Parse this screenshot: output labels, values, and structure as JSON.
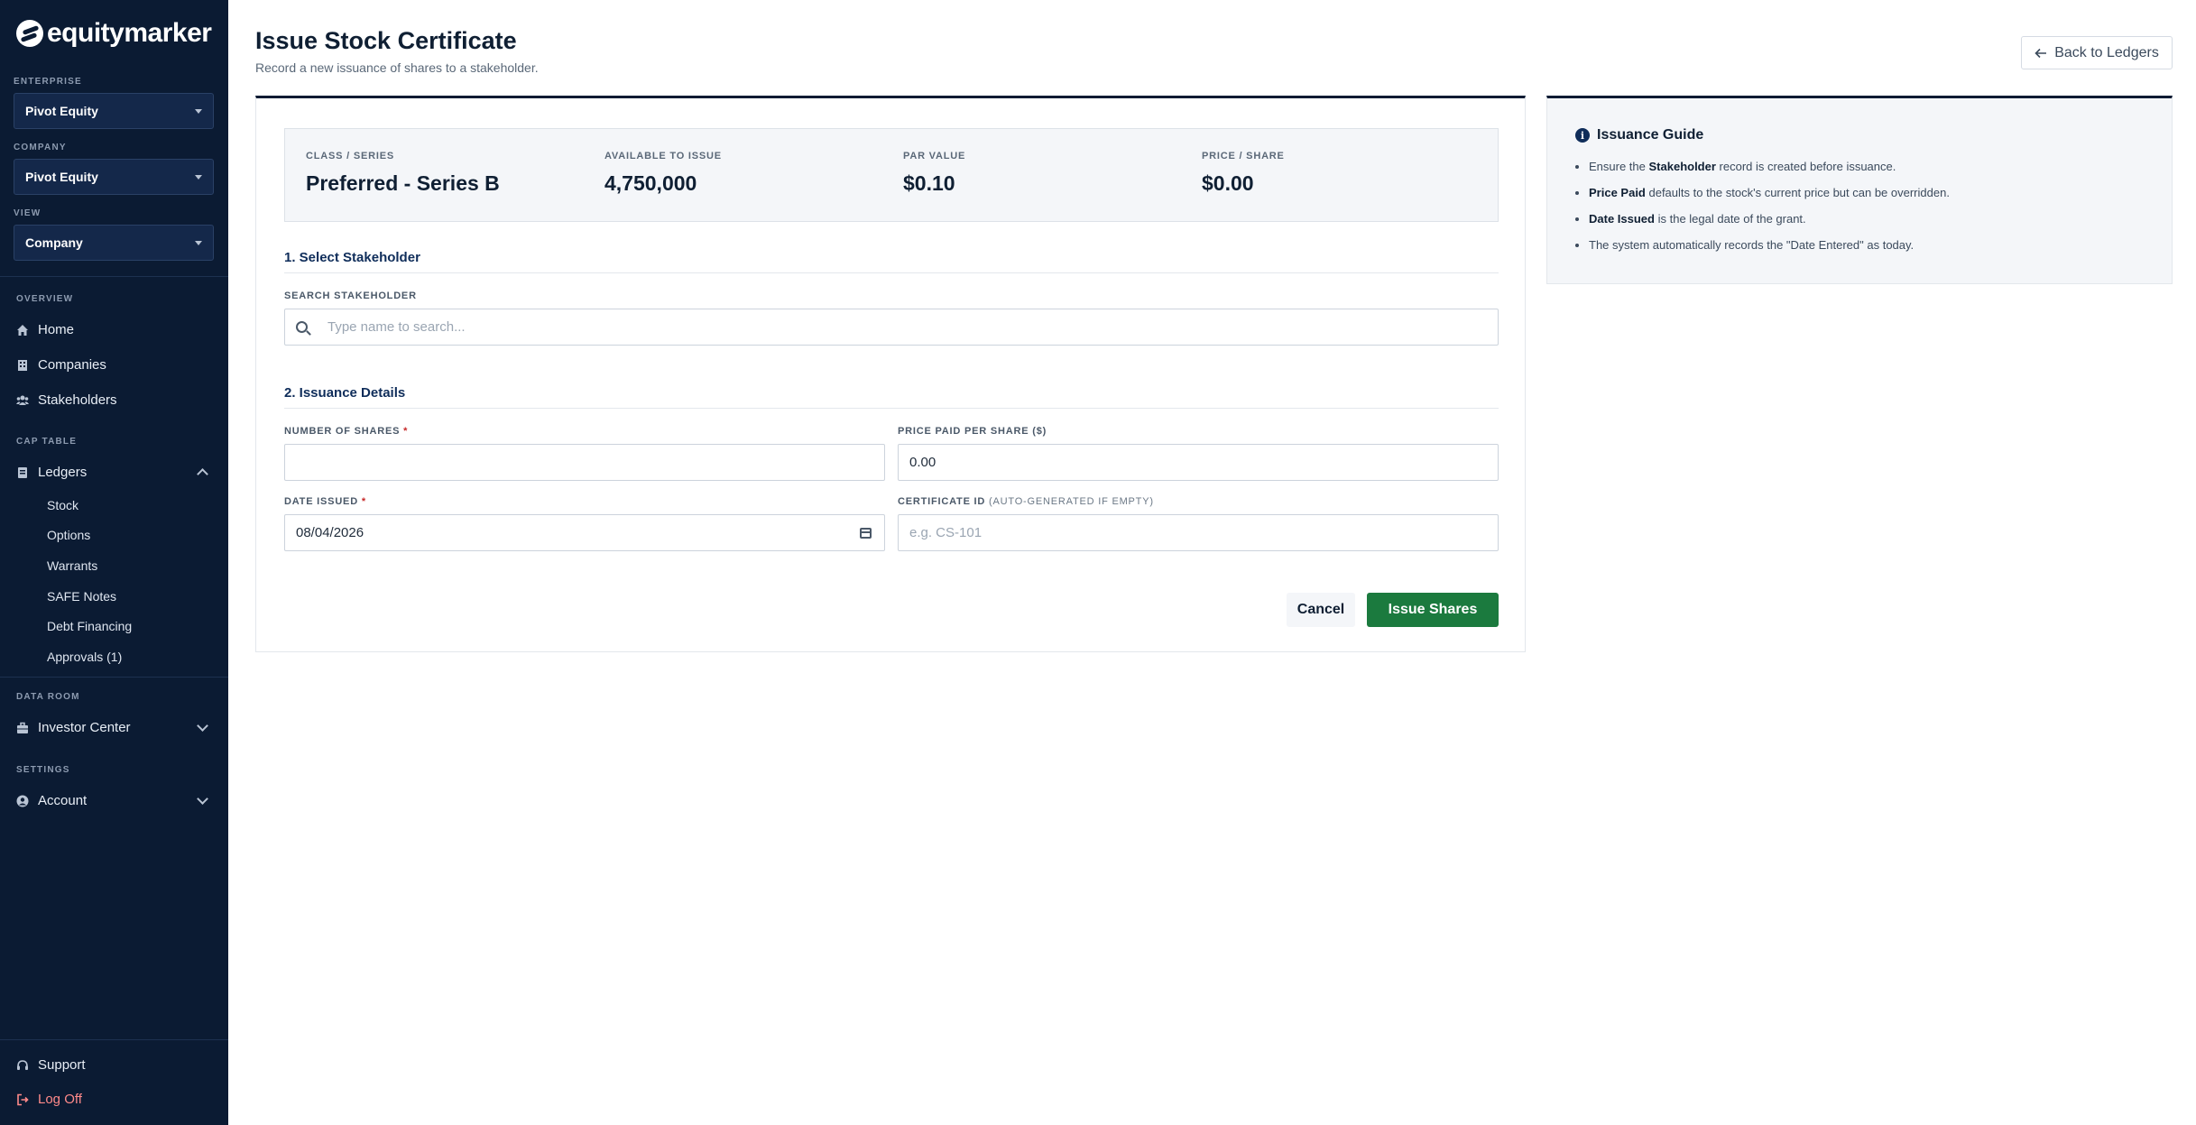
{
  "brand": {
    "name": "equitymarker"
  },
  "sidebar": {
    "enterprise_label": "ENTERPRISE",
    "enterprise_value": "Pivot Equity",
    "company_label": "COMPANY",
    "company_value": "Pivot Equity",
    "view_label": "VIEW",
    "view_value": "Company",
    "overview_label": "OVERVIEW",
    "home": "Home",
    "companies": "Companies",
    "stakeholders": "Stakeholders",
    "cap_table_label": "CAP TABLE",
    "ledgers": "Ledgers",
    "ledger_items": [
      "Stock",
      "Options",
      "Warrants",
      "SAFE Notes",
      "Debt Financing",
      "Approvals (1)"
    ],
    "data_room_label": "DATA ROOM",
    "investor_center": "Investor Center",
    "settings_label": "SETTINGS",
    "account": "Account",
    "support": "Support",
    "log_off": "Log Off"
  },
  "header": {
    "title": "Issue Stock Certificate",
    "subtitle": "Record a new issuance of shares to a stakeholder.",
    "back_label": "Back to Ledgers"
  },
  "stats": [
    {
      "label": "CLASS / SERIES",
      "value": "Preferred - Series B"
    },
    {
      "label": "AVAILABLE TO ISSUE",
      "value": "4,750,000"
    },
    {
      "label": "PAR VALUE",
      "value": "$0.10"
    },
    {
      "label": "PRICE / SHARE",
      "value": "$0.00"
    }
  ],
  "form": {
    "section1": "1. Select Stakeholder",
    "search_label": "SEARCH STAKEHOLDER",
    "search_placeholder": "Type name to search...",
    "section2": "2. Issuance Details",
    "shares_label": "NUMBER OF SHARES",
    "required_mark": "*",
    "price_label": "PRICE PAID PER SHARE ($)",
    "price_value": "0.00",
    "date_label": "DATE ISSUED",
    "date_value": "08/04/2026",
    "cert_label": "CERTIFICATE ID",
    "cert_hint": "(AUTO-GENERATED IF EMPTY)",
    "cert_placeholder": "e.g. CS-101",
    "cancel": "Cancel",
    "submit": "Issue Shares"
  },
  "guide": {
    "title": "Issuance Guide",
    "item1_pre": "Ensure the ",
    "item1_bold": "Stakeholder",
    "item1_post": " record is created before issuance.",
    "item2_bold": "Price Paid",
    "item2_post": " defaults to the stock's current price but can be overridden.",
    "item3_bold": "Date Issued",
    "item3_post": " is the legal date of the grant.",
    "item4": "The system automatically records the \"Date Entered\" as today."
  },
  "colors": {
    "sidebar_bg": "#0b1b33",
    "primary_green": "#1b7a3e",
    "required_red": "#c62828",
    "logoff_red": "#ff8a8a"
  }
}
